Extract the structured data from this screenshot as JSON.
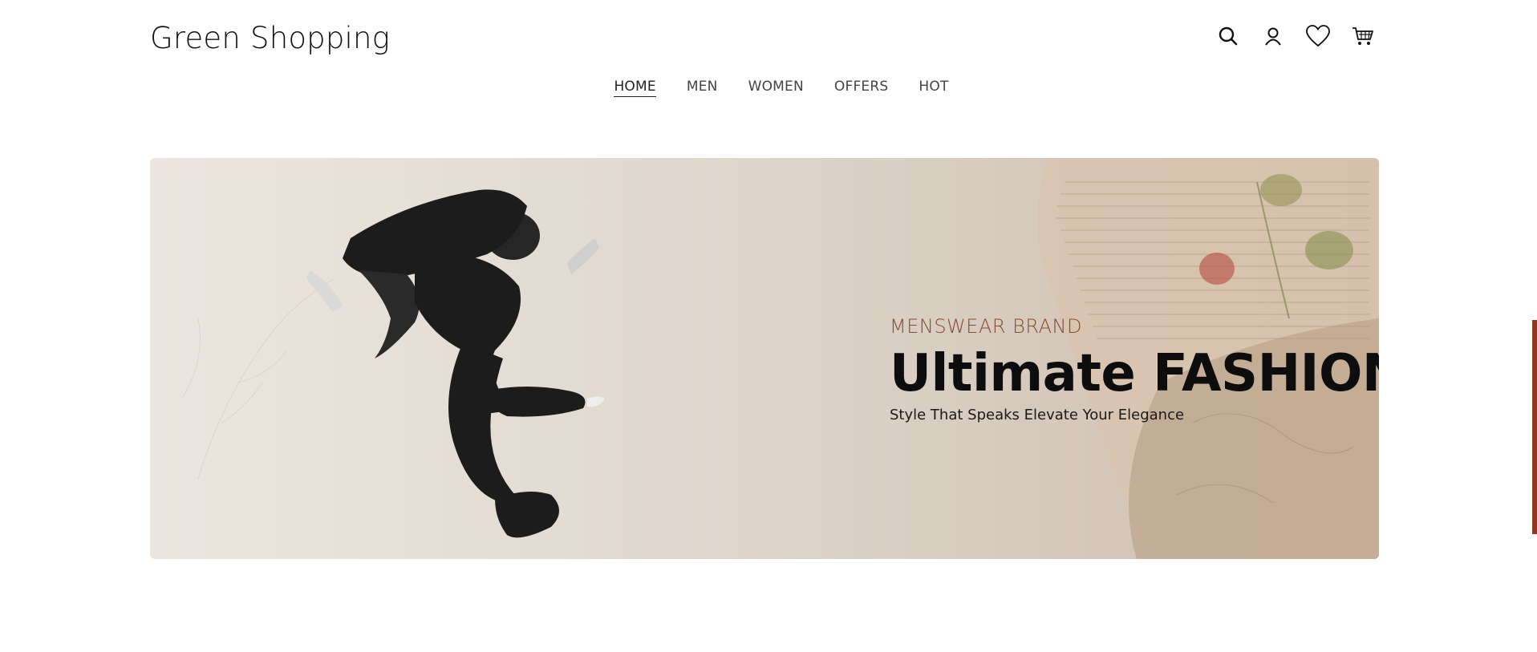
{
  "header": {
    "brand": "Green Shopping",
    "icons": [
      "search-icon",
      "user-icon",
      "heart-icon",
      "cart-icon"
    ]
  },
  "nav": {
    "items": [
      {
        "label": "HOME",
        "active": true
      },
      {
        "label": "MEN",
        "active": false
      },
      {
        "label": "WOMEN",
        "active": false
      },
      {
        "label": "OFFERS",
        "active": false
      },
      {
        "label": "HOT",
        "active": false
      }
    ]
  },
  "hero": {
    "tagline": "MENSWEAR BRAND",
    "headline": "Ultimate FASHION",
    "subline": "Style That Speaks Elevate Your Elegance"
  },
  "colors": {
    "accent": "#8b3a23",
    "tagline": "#8a4a2f",
    "hero_bg_start": "#ebe6df",
    "hero_bg_end": "#cdbcab"
  }
}
